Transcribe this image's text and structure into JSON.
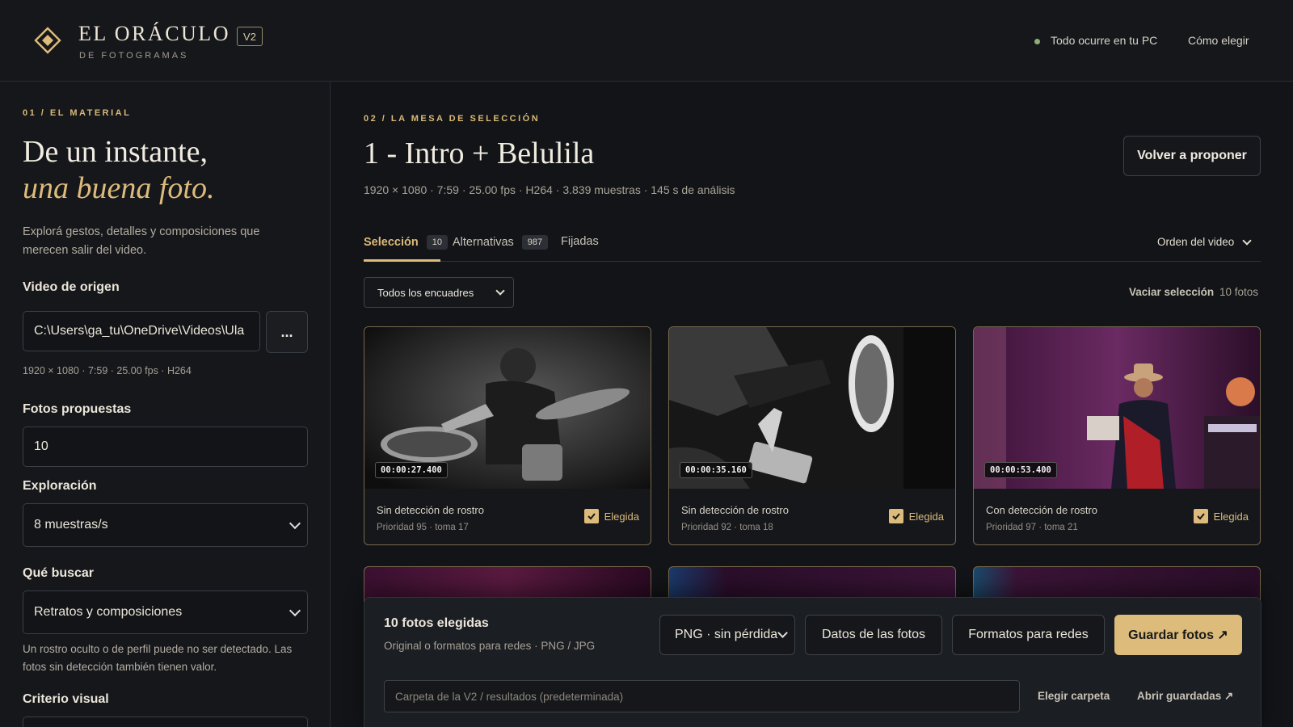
{
  "header": {
    "title": "EL ORÁCULO",
    "version": "V2",
    "subtitle": "DE FOTOGRAMAS",
    "status": "Todo ocurre en tu PC",
    "how_link": "Cómo elegir"
  },
  "sidebar": {
    "section": "01 / EL MATERIAL",
    "hero_line1": "De un instante,",
    "hero_line2": "una buena foto.",
    "intro": "Explorá gestos, detalles y composiciones que merecen salir del video.",
    "source_label": "Video de origen",
    "source_path": "C:\\Users\\ga_tu\\OneDrive\\Videos\\Ula",
    "browse_label": "...",
    "source_meta": "1920 × 1080 · 7:59 · 25.00 fps · H264",
    "count_label": "Fotos propuestas",
    "count_value": "10",
    "explore_label": "Exploración",
    "explore_value": "8 muestras/s",
    "search_label": "Qué buscar",
    "search_value": "Retratos y composiciones",
    "help": "Un rostro oculto o de perfil puede no ser detectado. Las fotos sin detección también tienen valor.",
    "criteria_label": "Criterio visual"
  },
  "main": {
    "section": "02 / LA MESA DE SELECCIÓN",
    "title": "1 - Intro + Belulila",
    "meta": "1920 × 1080 · 7:59 · 25.00 fps · H264 · 3.839 muestras · 145 s de análisis",
    "repropose": "Volver a proponer",
    "tabs": [
      {
        "label": "Selección",
        "count": "10"
      },
      {
        "label": "Alternativas",
        "count": "987"
      },
      {
        "label": "Fijadas"
      }
    ],
    "order": "Orden del video",
    "framing": "Todos los encuadres",
    "empty_selection": "Vaciar selección",
    "photo_count": "10 fotos",
    "cards": [
      {
        "timecode": "00:00:27.400",
        "title": "Sin detección de rostro",
        "sub": "Prioridad 95 · toma 17",
        "chosen": "Elegida"
      },
      {
        "timecode": "00:00:35.160",
        "title": "Sin detección de rostro",
        "sub": "Prioridad 92 · toma 18",
        "chosen": "Elegida"
      },
      {
        "timecode": "00:00:53.400",
        "title": "Con detección de rostro",
        "sub": "Prioridad 97 · toma 21",
        "chosen": "Elegida"
      }
    ]
  },
  "panel": {
    "title": "10 fotos elegidas",
    "sub": "Original o formatos para redes · PNG / JPG",
    "format": "PNG · sin pérdida",
    "data_button": "Datos de las fotos",
    "social_button": "Formatos para redes",
    "save_button": "Guardar fotos ↗",
    "folder_placeholder": "Carpeta de la V2 / resultados (predeterminada)",
    "choose_folder": "Elegir carpeta",
    "open_saved": "Abrir guardadas ↗"
  },
  "colors": {
    "accent": "#dcbb7b",
    "background": "#121417",
    "status": "#8fae74"
  },
  "icons": [
    "diamond-logo-icon",
    "status-dot-icon",
    "chevron-down-icon",
    "check-icon"
  ]
}
